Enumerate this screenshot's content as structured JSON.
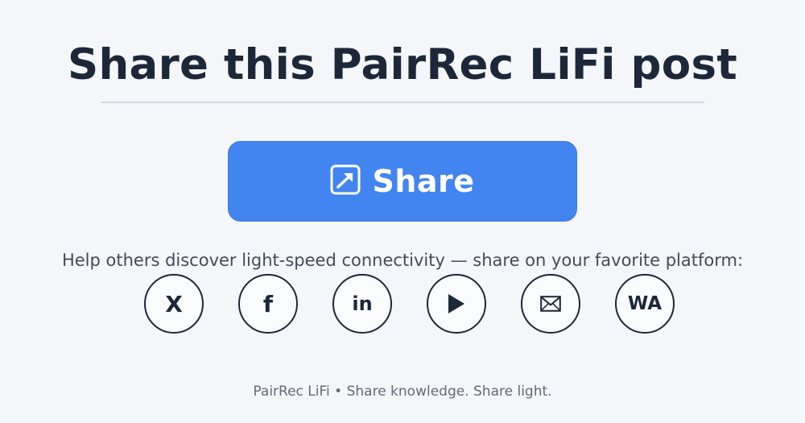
{
  "header": {
    "title": "Share this PairRec LiFi post"
  },
  "share_button": {
    "label": "Share",
    "icon": "share-arrow-icon"
  },
  "help_text": "Help others discover light-speed connectivity — share on your favorite platform:",
  "social": [
    {
      "platform": "x",
      "label": "X",
      "icon": "x-icon"
    },
    {
      "platform": "facebook",
      "label": "f",
      "icon": "facebook-icon"
    },
    {
      "platform": "linkedin",
      "label": "in",
      "icon": "linkedin-icon"
    },
    {
      "platform": "youtube",
      "label": "▶",
      "icon": "play-icon"
    },
    {
      "platform": "email",
      "label": "✉",
      "icon": "envelope-icon"
    },
    {
      "platform": "whatsapp",
      "label": "WA",
      "icon": "whatsapp-icon"
    }
  ],
  "footer": {
    "text": "PairRec LiFi • Share knowledge. Share light."
  },
  "colors": {
    "background": "#f4f6f9",
    "title": "#1c283a",
    "accent": "#4285f0",
    "icon_border": "#1c283a",
    "muted_text": "#626b78"
  }
}
